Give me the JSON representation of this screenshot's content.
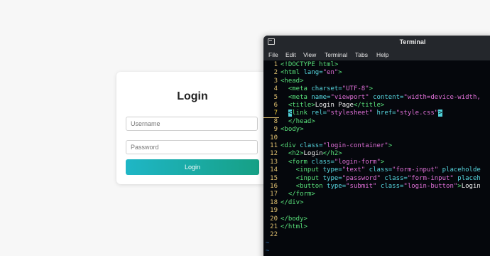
{
  "login": {
    "title": "Login",
    "username_placeholder": "Username",
    "password_placeholder": "Password",
    "button_label": "Login"
  },
  "terminal": {
    "title": "Terminal",
    "menu": [
      "File",
      "Edit",
      "View",
      "Terminal",
      "Tabs",
      "Help"
    ],
    "current_line": 7,
    "lines": [
      {
        "n": "1",
        "tokens": [
          {
            "t": "<!DOCTYPE html>",
            "c": "tag"
          }
        ]
      },
      {
        "n": "2",
        "tokens": [
          {
            "t": "<html ",
            "c": "tag"
          },
          {
            "t": "lang=",
            "c": "attr"
          },
          {
            "t": "\"en\"",
            "c": "str"
          },
          {
            "t": ">",
            "c": "tag"
          }
        ]
      },
      {
        "n": "3",
        "tokens": [
          {
            "t": "<head>",
            "c": "tag"
          }
        ]
      },
      {
        "n": "4",
        "tokens": [
          {
            "t": "  <meta ",
            "c": "tag"
          },
          {
            "t": "charset=",
            "c": "attr"
          },
          {
            "t": "\"UTF-8\"",
            "c": "str"
          },
          {
            "t": ">",
            "c": "tag"
          }
        ]
      },
      {
        "n": "5",
        "tokens": [
          {
            "t": "  <meta ",
            "c": "tag"
          },
          {
            "t": "name=",
            "c": "attr"
          },
          {
            "t": "\"viewport\" ",
            "c": "str"
          },
          {
            "t": "content=",
            "c": "attr"
          },
          {
            "t": "\"width=device-width,",
            "c": "str"
          }
        ]
      },
      {
        "n": "6",
        "tokens": [
          {
            "t": "  <title>",
            "c": "tag"
          },
          {
            "t": "Login Page",
            "c": "txt"
          },
          {
            "t": "</title>",
            "c": "tag"
          }
        ]
      },
      {
        "n": "7",
        "tokens": [
          {
            "t": "  ",
            "c": "txt"
          },
          {
            "t": "<",
            "c": "cur"
          },
          {
            "t": "link ",
            "c": "tag"
          },
          {
            "t": "rel=",
            "c": "attr"
          },
          {
            "t": "\"stylesheet\" ",
            "c": "str"
          },
          {
            "t": "href=",
            "c": "attr"
          },
          {
            "t": "\"style.css\"",
            "c": "str"
          },
          {
            "t": ">",
            "c": "cur"
          }
        ]
      },
      {
        "n": "8",
        "tokens": [
          {
            "t": "  </head>",
            "c": "tag"
          }
        ]
      },
      {
        "n": "9",
        "tokens": [
          {
            "t": "<body>",
            "c": "tag"
          }
        ]
      },
      {
        "n": "10",
        "tokens": []
      },
      {
        "n": "11",
        "tokens": [
          {
            "t": "<div ",
            "c": "tag"
          },
          {
            "t": "class=",
            "c": "attr"
          },
          {
            "t": "\"login-container\"",
            "c": "str"
          },
          {
            "t": ">",
            "c": "tag"
          }
        ]
      },
      {
        "n": "12",
        "tokens": [
          {
            "t": "  <h2>",
            "c": "tag"
          },
          {
            "t": "Login",
            "c": "txt"
          },
          {
            "t": "</h2>",
            "c": "tag"
          }
        ]
      },
      {
        "n": "13",
        "tokens": [
          {
            "t": "  <form ",
            "c": "tag"
          },
          {
            "t": "class=",
            "c": "attr"
          },
          {
            "t": "\"login-form\"",
            "c": "str"
          },
          {
            "t": ">",
            "c": "tag"
          }
        ]
      },
      {
        "n": "14",
        "tokens": [
          {
            "t": "    <input ",
            "c": "tag"
          },
          {
            "t": "type=",
            "c": "attr"
          },
          {
            "t": "\"text\" ",
            "c": "str"
          },
          {
            "t": "class=",
            "c": "attr"
          },
          {
            "t": "\"form-input\" ",
            "c": "str"
          },
          {
            "t": "placeholde",
            "c": "attr"
          }
        ]
      },
      {
        "n": "15",
        "tokens": [
          {
            "t": "    <input ",
            "c": "tag"
          },
          {
            "t": "type=",
            "c": "attr"
          },
          {
            "t": "\"password\" ",
            "c": "str"
          },
          {
            "t": "class=",
            "c": "attr"
          },
          {
            "t": "\"form-input\" ",
            "c": "str"
          },
          {
            "t": "placeh",
            "c": "attr"
          }
        ]
      },
      {
        "n": "16",
        "tokens": [
          {
            "t": "    <button ",
            "c": "tag"
          },
          {
            "t": "type=",
            "c": "attr"
          },
          {
            "t": "\"submit\" ",
            "c": "str"
          },
          {
            "t": "class=",
            "c": "attr"
          },
          {
            "t": "\"login-button\"",
            "c": "str"
          },
          {
            "t": ">",
            "c": "tag"
          },
          {
            "t": "Login",
            "c": "txt"
          }
        ]
      },
      {
        "n": "17",
        "tokens": [
          {
            "t": "  </form>",
            "c": "tag"
          }
        ]
      },
      {
        "n": "18",
        "tokens": [
          {
            "t": "</div>",
            "c": "tag"
          }
        ]
      },
      {
        "n": "19",
        "tokens": []
      },
      {
        "n": "20",
        "tokens": [
          {
            "t": "</body>",
            "c": "tag"
          }
        ]
      },
      {
        "n": "21",
        "tokens": [
          {
            "t": "</html>",
            "c": "tag"
          }
        ]
      },
      {
        "n": "22",
        "tokens": []
      }
    ],
    "tilde_lines": [
      "~",
      "~"
    ]
  },
  "colors": {
    "accent_start": "#1fb6c6",
    "accent_end": "#16a085",
    "terminal_bg": "#05070c",
    "tag": "#58e07a",
    "attr": "#57d7e0",
    "string": "#e070d8",
    "line_number": "#e0c070"
  }
}
